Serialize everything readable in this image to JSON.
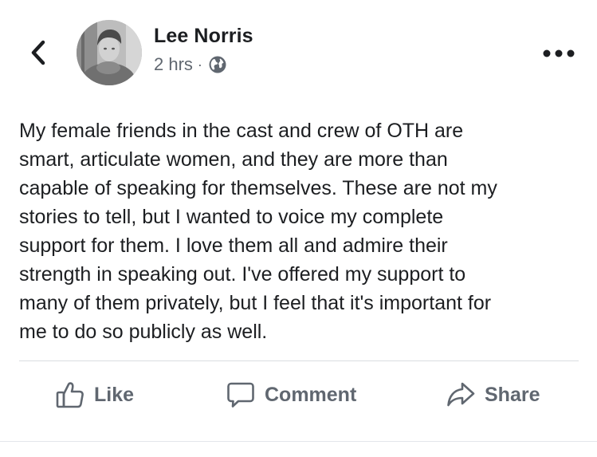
{
  "post": {
    "author": "Lee Norris",
    "timestamp": "2 hrs",
    "separator": "·",
    "privacy_icon": "globe-icon",
    "text": "My female friends in the cast and crew of OTH are\nsmart, articulate women, and they are more than\ncapable of speaking for themselves. These are not my\nstories to tell, but I wanted to voice my complete\nsupport for them. I love them all and admire their\nstrength in speaking out. I've offered my support to\nmany of them privately, but I feel that it's important for\nme to do so publicly as well."
  },
  "header": {
    "back_icon": "chevron-left-icon",
    "more_icon": "more-options-icon"
  },
  "actions": {
    "like_label": "Like",
    "comment_label": "Comment",
    "share_label": "Share"
  },
  "colors": {
    "text": "#1c1e21",
    "secondary_text": "#606770",
    "divider": "#dadde1"
  }
}
